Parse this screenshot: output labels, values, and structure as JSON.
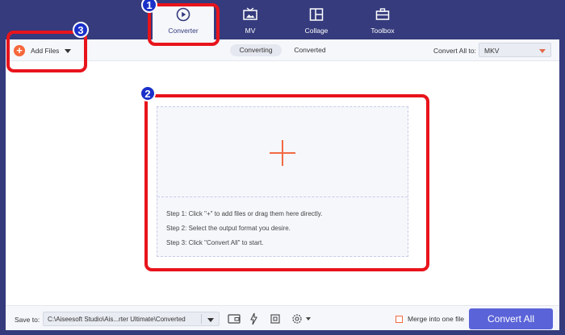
{
  "nav": {
    "tabs": [
      {
        "label": "Converter",
        "icon": "converter-icon"
      },
      {
        "label": "MV",
        "icon": "mv-icon"
      },
      {
        "label": "Collage",
        "icon": "collage-icon"
      },
      {
        "label": "Toolbox",
        "icon": "toolbox-icon"
      }
    ],
    "active_index": 0
  },
  "toolbar": {
    "add_files": "Add Files",
    "segments": [
      "Converting",
      "Converted"
    ],
    "convert_all_label": "Convert All to:",
    "format": "MKV"
  },
  "dropzone": {
    "steps": [
      "Step 1: Click \"+\" to add files or drag them here directly.",
      "Step 2: Select the output format you desire.",
      "Step 3: Click \"Convert All\" to start."
    ]
  },
  "bottom": {
    "save_to_label": "Save to:",
    "path": "C:\\Aiseesoft Studio\\Ais...rter Ultimate\\Converted",
    "merge_label": "Merge into one file",
    "convert_all_button": "Convert All"
  },
  "annotations": {
    "badges": [
      "1",
      "2",
      "3"
    ]
  },
  "colors": {
    "nav_bg": "#353b7c",
    "accent": "#f26a43",
    "primary_button": "#5a63d8",
    "highlight": "#e8141c",
    "badge": "#1a30c9"
  }
}
